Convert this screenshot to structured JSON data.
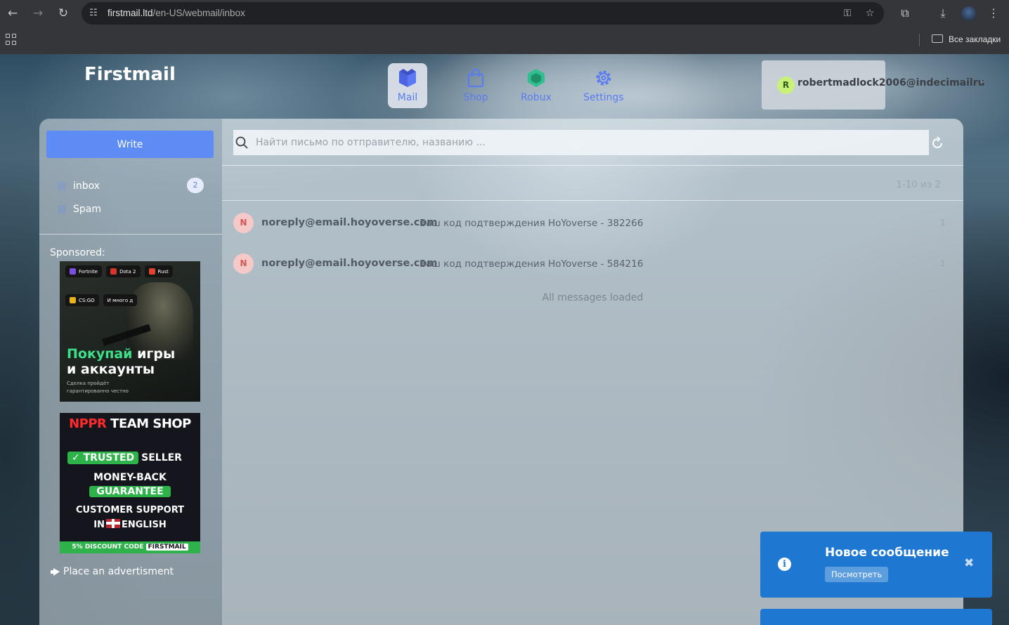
{
  "browser": {
    "url_host": "firstmail.ltd",
    "url_path": "/en-US/webmail/inbox",
    "bookmarks_label": "Все закладки"
  },
  "app": {
    "brand": "Firstmail",
    "nav": [
      {
        "label": "Mail",
        "icon": "mail-logo-icon",
        "active": true
      },
      {
        "label": "Shop",
        "icon": "shopping-bag-icon",
        "active": false
      },
      {
        "label": "Robux",
        "icon": "robux-hexagon-icon",
        "active": false
      },
      {
        "label": "Settings",
        "icon": "gear-icon",
        "active": false
      }
    ],
    "user": {
      "initial": "R",
      "email": "robertmadlock2006@indecimailru"
    }
  },
  "sidebar": {
    "write_label": "Write",
    "folders": [
      {
        "label": "inbox",
        "badge": "2"
      },
      {
        "label": "Spam",
        "badge": ""
      }
    ],
    "sponsored_label": "Sponsored:",
    "ad1": {
      "chips": [
        "Fortnite",
        "Dota 2",
        "Rust"
      ],
      "chips2": [
        "CS:GO",
        "И много д"
      ],
      "headline_green": "Покупай",
      "headline_rest1": " игры",
      "headline_line2": "и аккаунты",
      "subtext": "Сделка пройдёт гарантированно честно"
    },
    "ad2": {
      "title_red": "NPPR",
      "title_white": " TEAM SHOP",
      "trusted": "TRUSTED",
      "seller": "SELLER",
      "money_back": "MONEY-BACK",
      "guarantee": "GUARANTEE",
      "support": "CUSTOMER SUPPORT",
      "in": "IN",
      "english": "ENGLISH",
      "discount": "5% DISCOUNT CODE",
      "code": "FIRSTMAIL"
    },
    "place_ad_label": "Place an advertisment"
  },
  "main": {
    "search_placeholder": "Найти письмо по отправителю, названию ...",
    "pager": "1-10 из 2",
    "messages": [
      {
        "initial": "N",
        "from": "noreply@email.hoyoverse.com",
        "subject": "Ваш код подтверждения HoYoverse - 382266",
        "num": "1"
      },
      {
        "initial": "N",
        "from": "noreply@email.hoyoverse.com",
        "subject": "Ваш код подтверждения HoYoverse - 584216",
        "num": "1"
      }
    ],
    "loaded_text": "All messages loaded"
  },
  "toast": {
    "title": "Новое сообщение",
    "view_label": "Посмотреть",
    "close_glyph": "✖",
    "info_glyph": "i"
  },
  "colors": {
    "accent": "#5d8cf5",
    "toast": "#1e78d2",
    "nav_label": "#5b7bf0",
    "avatar_user": "#c8f07a",
    "avatar_msg": "#f6c9c9",
    "ad_green": "#2db34a",
    "ad_red": "#ff2a2a"
  }
}
